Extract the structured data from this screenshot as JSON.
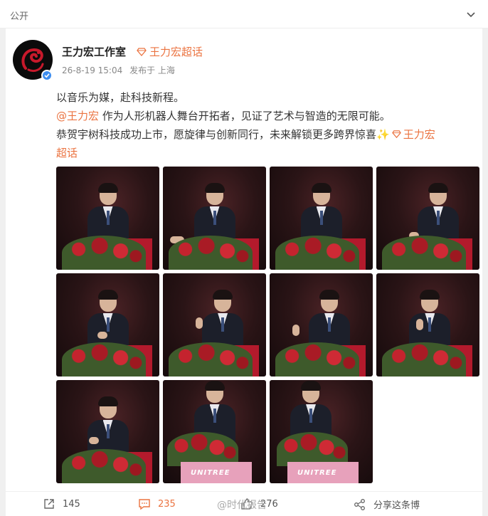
{
  "topbar": {
    "visibility": "公开",
    "chevron_icon": "chevron-down-icon"
  },
  "post": {
    "author": "王力宏工作室",
    "topic_link": "王力宏超话",
    "timestamp": "26-8-19 15:04",
    "posted_from": "发布于 上海",
    "lines": {
      "line1": "以音乐为媒，赴科技新程。",
      "mention": "@王力宏",
      "line2_rest": " 作为人形机器人舞台开拓者，见证了艺术与智造的无限可能。",
      "line3": "恭贺宇树科技成功上市，愿旋律与创新同行，未来解锁更多跨界惊喜",
      "sparkle": "✨",
      "topic_inline_a": "王力宏",
      "topic_inline_b": "超话"
    },
    "photo_brand_text": "UNITREE",
    "photo_count": 11
  },
  "actions": {
    "forward_count": "145",
    "comment_count": "235",
    "like_count": "276",
    "share_label": "分享这条博",
    "watermark": "@时代报告"
  },
  "colors": {
    "accent": "#eb7340",
    "badge": "#3d8ef0",
    "podium": "#b31a2c"
  }
}
